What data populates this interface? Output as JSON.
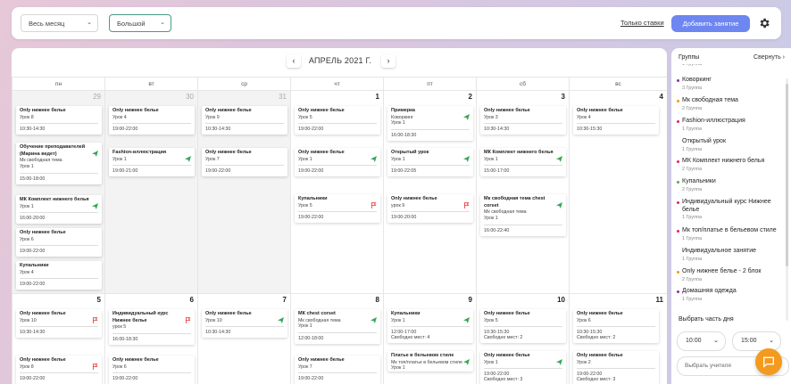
{
  "toolbar": {
    "period_select": "Весь месяц",
    "size_select": "Большой",
    "only_rates_link": "Только ставки",
    "add_lesson_button": "Добавить занятие",
    "settings_icon": "gear-icon"
  },
  "calendar": {
    "month_title": "АПРЕЛЬ 2021 Г.",
    "prev_icon": "chevron-left-icon",
    "next_icon": "chevron-right-icon",
    "weekdays": [
      "пн",
      "вт",
      "ср",
      "чт",
      "пт",
      "сб",
      "вс"
    ],
    "weeks": [
      {
        "days": [
          {
            "num": "29",
            "dim": true,
            "events": [
              {
                "title": "Only нижнее белье",
                "lines": [
                  "Урок 8"
                ],
                "time": "10:30-14:30",
                "icon": ""
              },
              {
                "title": "Обучение преподавателей (Марина ведет)",
                "lines": [
                  "Мк свободная тема",
                  "Урок 1"
                ],
                "time": "15:00-18:00",
                "icon": "send"
              },
              {
                "title": "МК Комплект нижнего белья",
                "lines": [
                  "Урок 1"
                ],
                "time": "16:00-20:00",
                "icon": "send"
              },
              {
                "title": "Only нижнее белье",
                "lines": [
                  "Урок 6"
                ],
                "time": "19:00-22:00",
                "icon": ""
              },
              {
                "title": "Купальники",
                "lines": [
                  "Урок 4"
                ],
                "time": "19:00-22:00",
                "icon": ""
              }
            ]
          },
          {
            "num": "30",
            "dim": true,
            "events": [
              {
                "title": "Only нижнее белье",
                "lines": [
                  "Урок 4"
                ],
                "time": "19:00-22:00",
                "icon": ""
              },
              {
                "title": "Fashion-иллюстрация",
                "lines": [
                  "Урок 1"
                ],
                "time": "19:00-21:00",
                "icon": "send"
              }
            ]
          },
          {
            "num": "31",
            "dim": true,
            "events": [
              {
                "title": "Only нижнее белье",
                "lines": [
                  "Урок 9"
                ],
                "time": "10:30-14:30",
                "icon": ""
              },
              {
                "title": "Only нижнее белье",
                "lines": [
                  "Урок 7"
                ],
                "time": "19:00-22:00",
                "icon": ""
              }
            ]
          },
          {
            "num": "1",
            "dim": false,
            "events": [
              {
                "title": "Only нижнее белье",
                "lines": [
                  "Урок 5"
                ],
                "time": "19:00-22:00",
                "icon": ""
              },
              {
                "title": "Only нижнее белье",
                "lines": [
                  "Урок 1"
                ],
                "time": "19:00-22:00",
                "icon": "send"
              },
              {
                "title": "Купальники",
                "lines": [
                  "Урок 5"
                ],
                "time": "19:00-22:00",
                "icon": "flag"
              }
            ]
          },
          {
            "num": "2",
            "dim": false,
            "events": [
              {
                "title": "Примерка",
                "lines": [
                  "Коворкинг",
                  "Урок 1"
                ],
                "time": "16:00-18:30",
                "icon": "send"
              },
              {
                "title": "Открытый урок",
                "lines": [
                  "Урок 1"
                ],
                "time": "19:00-22:05",
                "icon": "send"
              },
              {
                "title": "Only нижнее белье",
                "lines": [
                  "урок 9"
                ],
                "time": "19:00-20:00",
                "icon": "flag"
              }
            ]
          },
          {
            "num": "3",
            "dim": false,
            "events": [
              {
                "title": "Only нижнее белье",
                "lines": [
                  "Урок 3"
                ],
                "time": "10:30-14:30",
                "icon": ""
              },
              {
                "title": "МК Комплект нижнего белья",
                "lines": [
                  "Урок 1"
                ],
                "time": "15:00-17:00",
                "icon": "send"
              },
              {
                "title": "Мк свободная тема chest corset",
                "lines": [
                  "Мк свободная тема",
                  "Урок 1"
                ],
                "time": "16:00-22:40",
                "icon": "send"
              }
            ]
          },
          {
            "num": "4",
            "dim": false,
            "events": [
              {
                "title": "Only нижнее белье",
                "lines": [
                  "Урок 4"
                ],
                "time": "10:30-15:30",
                "icon": ""
              }
            ]
          }
        ]
      },
      {
        "days": [
          {
            "num": "5",
            "dim": false,
            "events": [
              {
                "title": "Only нижнее белье",
                "lines": [
                  "Урок 10"
                ],
                "time": "10:30-14:30",
                "icon": "flag"
              },
              {
                "title": "Only нижнее белье",
                "lines": [
                  "Урок 8"
                ],
                "time": "19:00-22:00",
                "icon": "flag"
              }
            ]
          },
          {
            "num": "6",
            "dim": false,
            "events": [
              {
                "title": "Индивидуальный курс Нижнее белье",
                "lines": [
                  "урок 5"
                ],
                "time": "16:00-18:30",
                "icon": "flag"
              },
              {
                "title": "Only нижнее белье",
                "lines": [
                  "Урок 6"
                ],
                "time": "19:00-22:00",
                "icon": ""
              }
            ]
          },
          {
            "num": "7",
            "dim": false,
            "events": [
              {
                "title": "Only нижнее белье",
                "lines": [
                  "Урок 10"
                ],
                "time": "10:30-14:30",
                "icon": "send"
              }
            ]
          },
          {
            "num": "8",
            "dim": false,
            "events": [
              {
                "title": "МК chest corset",
                "lines": [
                  "Мк свободная тема",
                  "Урок 1"
                ],
                "time": "12:00-18:00",
                "icon": "send"
              },
              {
                "title": "Only нижнее белье",
                "lines": [
                  "Урок 7"
                ],
                "time": "19:00-22:00",
                "icon": ""
              }
            ]
          },
          {
            "num": "9",
            "dim": false,
            "events": [
              {
                "title": "Купальники",
                "lines": [
                  "Урок 1"
                ],
                "time": "12:00-17:00",
                "time2": "Свободно мест: 4",
                "icon": "send"
              },
              {
                "title": "Платье в бельевом стиле",
                "lines": [
                  "Мк топ/платье в бельевом стиле",
                  "Урок 1"
                ],
                "time": "",
                "icon": "send"
              }
            ]
          },
          {
            "num": "10",
            "dim": false,
            "events": [
              {
                "title": "Only нижнее белье",
                "lines": [
                  "Урок 5"
                ],
                "time": "10:30-15:30",
                "time2": "Свободно мест: 2",
                "icon": ""
              },
              {
                "title": "Only нижнее белье",
                "lines": [
                  "Урок 1"
                ],
                "time": "19:00-22:00",
                "time2": "Свободно мест: 3",
                "icon": "send"
              }
            ]
          },
          {
            "num": "11",
            "dim": false,
            "events": [
              {
                "title": "Only нижнее белье",
                "lines": [
                  "Урок 6"
                ],
                "time": "10:30-15:30",
                "time2": "Свободно мест: 2",
                "icon": ""
              },
              {
                "title": "Only нижнее белье",
                "lines": [
                  "Урок 2"
                ],
                "time": "19:00-22:00",
                "time2": "Свободно мест: 3",
                "icon": ""
              }
            ]
          }
        ]
      }
    ]
  },
  "groups_panel": {
    "title": "Группы",
    "collapse": "Свернуть",
    "groups": [
      {
        "name": "",
        "count": "1 Группа",
        "color": "#4caf50"
      },
      {
        "name": "Коворкинг",
        "count": "3 Группа",
        "color": "#9c27b0"
      },
      {
        "name": "Мк свободная тема",
        "count": "2 Группа",
        "color": "#ff9800"
      },
      {
        "name": "Fashion-иллюстрация",
        "count": "1 Группа",
        "color": "#e91e63"
      },
      {
        "name": "Открытый урок",
        "count": "1 Группа",
        "color": ""
      },
      {
        "name": "МК Комплект нижнего белья",
        "count": "2 Группа",
        "color": "#e91e63"
      },
      {
        "name": "Купальники",
        "count": "2 Группа",
        "color": "#4caf50"
      },
      {
        "name": "Индивидуальный курс Нижнее белье",
        "count": "1 Группа",
        "color": "#e91e63"
      },
      {
        "name": "Мк топ/платье в бельевом стиле",
        "count": "1 Группа",
        "color": "#e91e63"
      },
      {
        "name": "Индивидуальное занятие",
        "count": "1 Группа",
        "color": ""
      },
      {
        "name": "Only нижнее белье - 2 блок",
        "count": "2 Группа",
        "color": "#ff9800"
      },
      {
        "name": "Домашняя одежда",
        "count": "1 Группа",
        "color": "#9c27b0"
      }
    ],
    "part_of_day_label": "Выбрать часть дня",
    "time_from": "10:00",
    "time_to": "15:00",
    "teacher_placeholder": "Выбрать учителя",
    "chat_icon": "chat-icon"
  }
}
